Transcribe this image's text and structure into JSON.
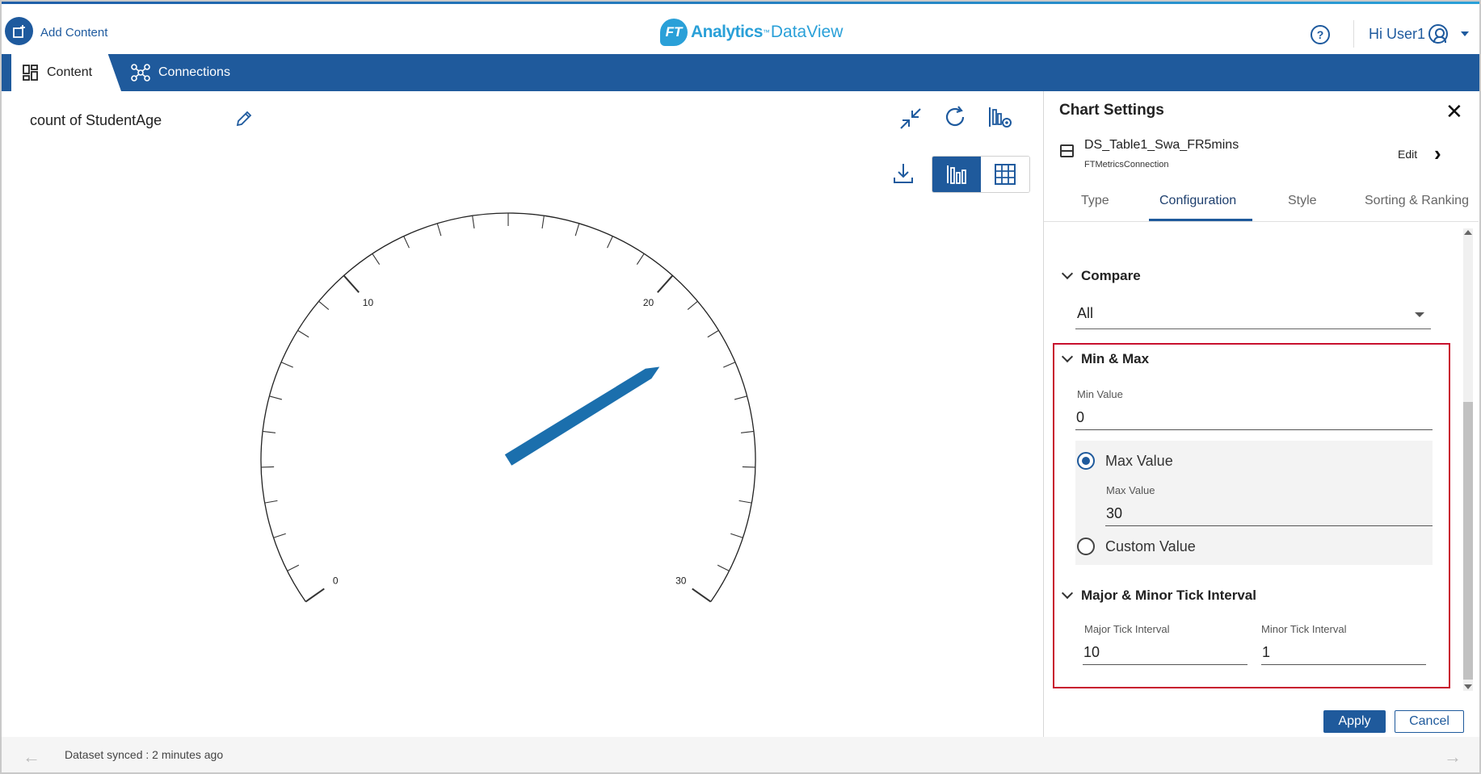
{
  "header": {
    "add_content_label": "Add Content",
    "logo_brand": "Analytics",
    "logo_tm": "™",
    "logo_product": "DataView",
    "logo_mark": "FT",
    "help_glyph": "?",
    "user_greeting": "Hi User1"
  },
  "nav": {
    "tabs": [
      {
        "label": "Content",
        "icon": "dashboard-grid-icon",
        "active": true
      },
      {
        "label": "Connections",
        "icon": "network-nodes-icon",
        "active": false
      }
    ]
  },
  "main": {
    "chart_title": "count of StudentAge",
    "toolbar": [
      "collapse-icon",
      "refresh-icon",
      "chart-settings-icon",
      "download-icon",
      "bar-chart-view-icon",
      "table-view-icon"
    ]
  },
  "chart_data": {
    "type": "gauge",
    "min": 0,
    "max": 30,
    "major_tick_interval": 10,
    "minor_tick_interval": 1,
    "tick_labels": [
      "0",
      "10",
      "20",
      "30"
    ],
    "value": 22,
    "needle_color": "#1b6fad"
  },
  "panel": {
    "title": "Chart Settings",
    "close_glyph": "✕",
    "dataset_name": "DS_Table1_Swa_FR5mins",
    "connection_name": "FTMetricsConnection",
    "edit_label": "Edit",
    "chevron_glyph": "›",
    "tabs": [
      {
        "label": "Type",
        "active": false
      },
      {
        "label": "Configuration",
        "active": true
      },
      {
        "label": "Style",
        "active": false
      },
      {
        "label": "Sorting & Ranking",
        "active": false
      }
    ],
    "compare": {
      "heading": "Compare",
      "selected": "All"
    },
    "min_max": {
      "heading": "Min & Max",
      "min_label": "Min Value",
      "min_value": "0",
      "max_option_label": "Max Value",
      "max_field_label": "Max Value",
      "max_value": "30",
      "custom_option_label": "Custom Value",
      "selected_option": "Max Value"
    },
    "ticks": {
      "heading": "Major & Minor Tick Interval",
      "major_label": "Major Tick Interval",
      "major_value": "10",
      "minor_label": "Minor Tick Interval",
      "minor_value": "1"
    },
    "apply_label": "Apply",
    "cancel_label": "Cancel",
    "highlight_color": "#c8102e"
  },
  "footer": {
    "status": "Dataset synced : 2 minutes ago",
    "back_glyph": "←",
    "forward_glyph": "→"
  },
  "colors": {
    "primary": "#1f5a9c",
    "accent": "#2aa0d8"
  }
}
